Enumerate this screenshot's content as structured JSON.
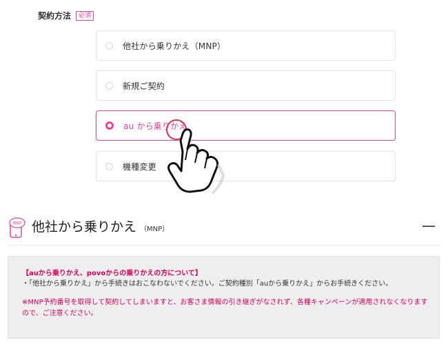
{
  "section": {
    "label": "契約方法",
    "required_badge": "必須"
  },
  "options": [
    {
      "label": "他社から乗りかえ（MNP）",
      "selected": false
    },
    {
      "label": "新規ご契約",
      "selected": false
    },
    {
      "label": "au から乗りかえ",
      "selected": true
    },
    {
      "label": "機種変更",
      "selected": false
    }
  ],
  "mnp": {
    "icon_text": "MNP",
    "title": "他社から乗りかえ",
    "subtitle": "（MNP）"
  },
  "notice": {
    "title": "【auから乗りかえ、povoからの乗りかえの方について】",
    "item": "・「他社から乗りかえ」から手続きはおこなわないでください。ご契約種別「auから乗りかえ」からお手続きください。",
    "warning": "※MNP予約番号を取得して契約してしまいますと、お客さま情報の引き継ぎがなされず、各種キャンペーンが適用されなくなりますので、ご注意ください。"
  },
  "colors": {
    "accent": "#e8449a",
    "warning": "#e0005a"
  },
  "icons": {
    "pointer": "pointing-hand-icon",
    "mnp": "smartphone-mnp-icon",
    "collapse": "minus-icon"
  }
}
